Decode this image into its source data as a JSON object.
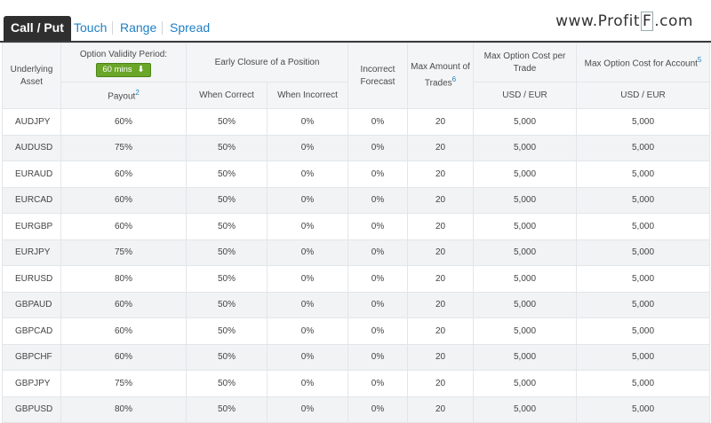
{
  "tabs": {
    "active": "Call / Put",
    "others": [
      "Touch",
      "Range",
      "Spread"
    ]
  },
  "brand": {
    "prefix": "www.Profit",
    "letter": "F",
    "suffix": ".com"
  },
  "header": {
    "underlying_asset": "Underlying Asset",
    "option_validity": "Option Validity Period:",
    "period_button": "60 mins",
    "early_closure": "Early Closure of a Position",
    "incorrect_forecast": "Incorrect Forecast",
    "max_trades": "Max Amount of Trades",
    "max_trades_sup": "6",
    "max_cost_trade": "Max Option Cost per Trade",
    "max_cost_account": "Max Option Cost for Account",
    "max_cost_account_sup": "5",
    "payout": "Payout",
    "payout_sup": "2",
    "when_correct": "When Correct",
    "when_incorrect": "When Incorrect",
    "currency_trade": "USD / EUR",
    "currency_account": "USD / EUR"
  },
  "rows": [
    {
      "asset": "AUDJPY",
      "payout": "60%",
      "correct": "50%",
      "incorrect": "0%",
      "forecast": "0%",
      "trades": "20",
      "cost_trade": "5,000",
      "cost_account": "5,000"
    },
    {
      "asset": "AUDUSD",
      "payout": "75%",
      "correct": "50%",
      "incorrect": "0%",
      "forecast": "0%",
      "trades": "20",
      "cost_trade": "5,000",
      "cost_account": "5,000"
    },
    {
      "asset": "EURAUD",
      "payout": "60%",
      "correct": "50%",
      "incorrect": "0%",
      "forecast": "0%",
      "trades": "20",
      "cost_trade": "5,000",
      "cost_account": "5,000"
    },
    {
      "asset": "EURCAD",
      "payout": "60%",
      "correct": "50%",
      "incorrect": "0%",
      "forecast": "0%",
      "trades": "20",
      "cost_trade": "5,000",
      "cost_account": "5,000"
    },
    {
      "asset": "EURGBP",
      "payout": "60%",
      "correct": "50%",
      "incorrect": "0%",
      "forecast": "0%",
      "trades": "20",
      "cost_trade": "5,000",
      "cost_account": "5,000"
    },
    {
      "asset": "EURJPY",
      "payout": "75%",
      "correct": "50%",
      "incorrect": "0%",
      "forecast": "0%",
      "trades": "20",
      "cost_trade": "5,000",
      "cost_account": "5,000"
    },
    {
      "asset": "EURUSD",
      "payout": "80%",
      "correct": "50%",
      "incorrect": "0%",
      "forecast": "0%",
      "trades": "20",
      "cost_trade": "5,000",
      "cost_account": "5,000"
    },
    {
      "asset": "GBPAUD",
      "payout": "60%",
      "correct": "50%",
      "incorrect": "0%",
      "forecast": "0%",
      "trades": "20",
      "cost_trade": "5,000",
      "cost_account": "5,000"
    },
    {
      "asset": "GBPCAD",
      "payout": "60%",
      "correct": "50%",
      "incorrect": "0%",
      "forecast": "0%",
      "trades": "20",
      "cost_trade": "5,000",
      "cost_account": "5,000"
    },
    {
      "asset": "GBPCHF",
      "payout": "60%",
      "correct": "50%",
      "incorrect": "0%",
      "forecast": "0%",
      "trades": "20",
      "cost_trade": "5,000",
      "cost_account": "5,000"
    },
    {
      "asset": "GBPJPY",
      "payout": "75%",
      "correct": "50%",
      "incorrect": "0%",
      "forecast": "0%",
      "trades": "20",
      "cost_trade": "5,000",
      "cost_account": "5,000"
    },
    {
      "asset": "GBPUSD",
      "payout": "80%",
      "correct": "50%",
      "incorrect": "0%",
      "forecast": "0%",
      "trades": "20",
      "cost_trade": "5,000",
      "cost_account": "5,000"
    }
  ]
}
